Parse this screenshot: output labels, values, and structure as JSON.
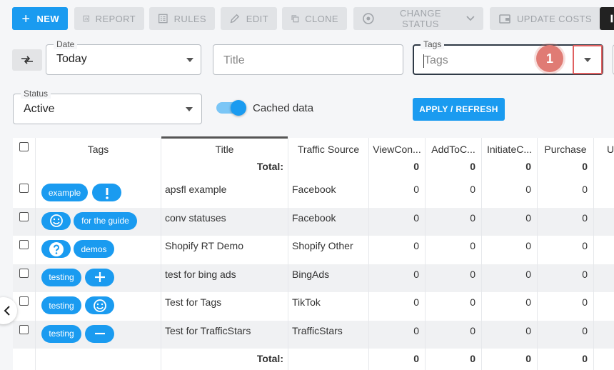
{
  "toolbar": {
    "new_label": "NEW",
    "report_label": "REPORT",
    "rules_label": "RULES",
    "edit_label": "EDIT",
    "clone_label": "CLONE",
    "change_status_label": "CHANGE STATUS",
    "update_costs_label": "UPDATE COSTS"
  },
  "filters": {
    "date_label": "Date",
    "date_value": "Today",
    "title_placeholder": "Title",
    "tags_label": "Tags",
    "tags_placeholder": "Tags",
    "step_badge": "1",
    "status_label": "Status",
    "status_value": "Active",
    "cached_label": "Cached data",
    "cached_enabled": true,
    "apply_label": "APPLY / REFRESH"
  },
  "colors": {
    "primary": "#1a9bf0",
    "highlight": "#e06060",
    "badge": "#e07b74"
  },
  "table": {
    "headers": {
      "tags": "Tags",
      "title": "Title",
      "traffic_source": "Traffic Source",
      "view_content": "ViewCon...",
      "add_to_cart": "AddToC...",
      "initiate_checkout": "InitiateC...",
      "purchase": "Purchase",
      "next": "U"
    },
    "total_label": "Total:",
    "header_totals": [
      "0",
      "0",
      "0",
      "0"
    ],
    "rows": [
      {
        "tag_text": "example",
        "tag_icon": "exclamation-icon",
        "title": "apsfl example",
        "source": "Facebook",
        "v1": "0",
        "v2": "0",
        "v3": "0",
        "v4": "0"
      },
      {
        "tag_icon": "smiley-icon",
        "tag_text": "for the guide",
        "title": "conv statuses",
        "source": "Facebook",
        "v1": "0",
        "v2": "0",
        "v3": "0",
        "v4": "0"
      },
      {
        "tag_icon": "question-icon",
        "tag_text": "demos",
        "title": "Shopify RT Demo",
        "source": "Shopify Other",
        "v1": "0",
        "v2": "0",
        "v3": "0",
        "v4": "0"
      },
      {
        "tag_text": "testing",
        "tag_icon": "plus-icon",
        "title": "test for bing ads",
        "source": "BingAds",
        "v1": "0",
        "v2": "0",
        "v3": "0",
        "v4": "0"
      },
      {
        "tag_text": "testing",
        "tag_icon": "smiley-icon",
        "title": "Test for Tags",
        "source": "TikTok",
        "v1": "0",
        "v2": "0",
        "v3": "0",
        "v4": "0"
      },
      {
        "tag_text": "testing",
        "tag_icon": "minus-icon",
        "title": "Test for TrafficStars",
        "source": "TrafficStars",
        "v1": "0",
        "v2": "0",
        "v3": "0",
        "v4": "0"
      }
    ],
    "footer_totals": [
      "0",
      "0",
      "0",
      "0"
    ]
  }
}
